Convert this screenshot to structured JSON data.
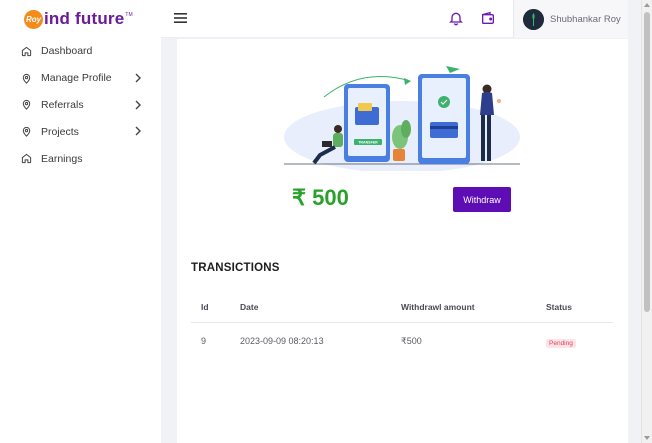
{
  "brand": {
    "badge": "Roy",
    "name": "ind future",
    "tm": "TM"
  },
  "sidebar": {
    "items": [
      {
        "label": "Dashboard",
        "icon": "home-icon",
        "has_submenu": false
      },
      {
        "label": "Manage Profile",
        "icon": "location-pin-icon",
        "has_submenu": true
      },
      {
        "label": "Referrals",
        "icon": "location-pin-icon",
        "has_submenu": true
      },
      {
        "label": "Projects",
        "icon": "location-pin-icon",
        "has_submenu": true
      },
      {
        "label": "Earnings",
        "icon": "home-icon",
        "has_submenu": false
      }
    ]
  },
  "header": {
    "icons": [
      "menu-icon",
      "bell-icon",
      "wallet-icon"
    ],
    "user": {
      "name": "Shubhankar Roy"
    }
  },
  "wallet": {
    "balance": "₹ 500",
    "withdraw_label": "Withdraw",
    "illustration_label": "TRANSFER"
  },
  "transactions": {
    "title": "TRANSICTIONS",
    "columns": [
      "Id",
      "Date",
      "Withdrawl amount",
      "Status"
    ],
    "rows": [
      {
        "id": "9",
        "date": "2023-09-09 08:20:13",
        "amount": "₹500",
        "status": "Pending"
      }
    ]
  },
  "colors": {
    "brand_purple": "#5e0db4",
    "balance_green": "#2aa12a",
    "pending_red": "#e0455a",
    "logo_orange": "#f28c1b"
  }
}
